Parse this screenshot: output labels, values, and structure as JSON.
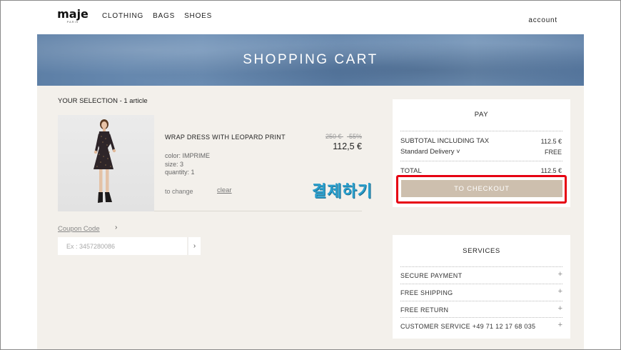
{
  "header": {
    "logo": "maje",
    "logo_sub": "PARIS",
    "nav": [
      "CLOTHING",
      "BAGS",
      "SHOES"
    ],
    "account": "account"
  },
  "banner": {
    "title": "SHOPPING CART"
  },
  "selection": {
    "title": "YOUR SELECTION - 1 article"
  },
  "product": {
    "name": "WRAP DRESS WITH LEOPARD PRINT",
    "old_price": "250 €",
    "discount": "-55%",
    "price": "112,5 €",
    "color": "color: IMPRIME",
    "size": "size: 3",
    "quantity": "quantity: 1",
    "change_label": "to change",
    "clear_label": "clear"
  },
  "coupon": {
    "label": "Coupon Code",
    "arrow": "›",
    "placeholder": "Ex : 3457280086",
    "submit": "›"
  },
  "annotation": "결제하기",
  "pay": {
    "title": "PAY",
    "subtotal_label": "SUBTOTAL INCLUDING TAX",
    "subtotal_value": "112.5 €",
    "delivery_label": "Standard Delivery ˅",
    "delivery_value": "FREE",
    "total_label": "TOTAL",
    "total_value": "112.5 €",
    "checkout": "TO CHECKOUT"
  },
  "services": {
    "title": "SERVICES",
    "items": [
      "SECURE PAYMENT",
      "FREE SHIPPING",
      "FREE RETURN",
      "CUSTOMER SERVICE +49 71 12 17 68 035"
    ],
    "expand_icon": "+"
  },
  "colors": {
    "background": "#f3f0eb",
    "checkout_button": "#cdbfae",
    "highlight": "#e60012",
    "annotation": "#2a9fcd",
    "banner": "#6388ae"
  }
}
